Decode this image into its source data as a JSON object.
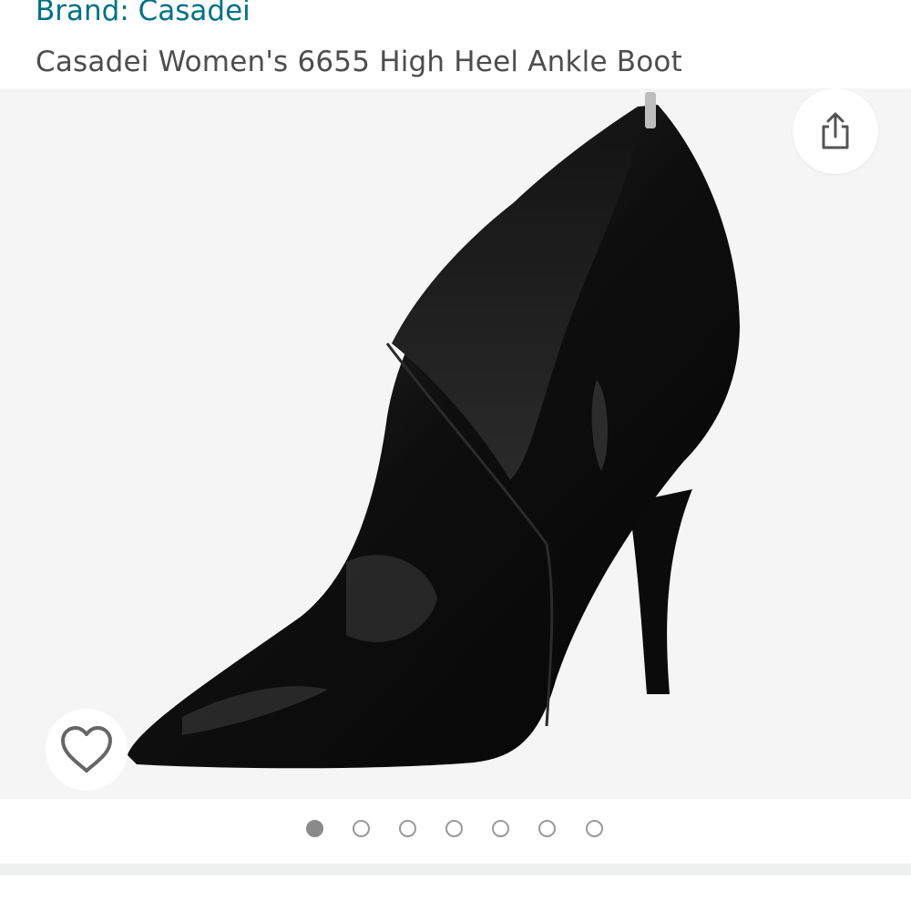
{
  "product": {
    "brand_link": "Brand: Casadei",
    "title": "Casadei Women's 6655 High Heel Ankle Boot"
  },
  "gallery": {
    "image_alt": "Black patent leather pointed-toe high heel ankle boot",
    "share_icon": "share-icon",
    "wishlist_icon": "heart-outline-icon",
    "image_count": 7,
    "active_index": 0
  },
  "colors": {
    "brand_link": "#007185",
    "title": "#4d4d4d",
    "gallery_bg": "#f5f5f5",
    "dot_active": "#8a8a8a",
    "dot_inactive_border": "#9a9a9a"
  }
}
